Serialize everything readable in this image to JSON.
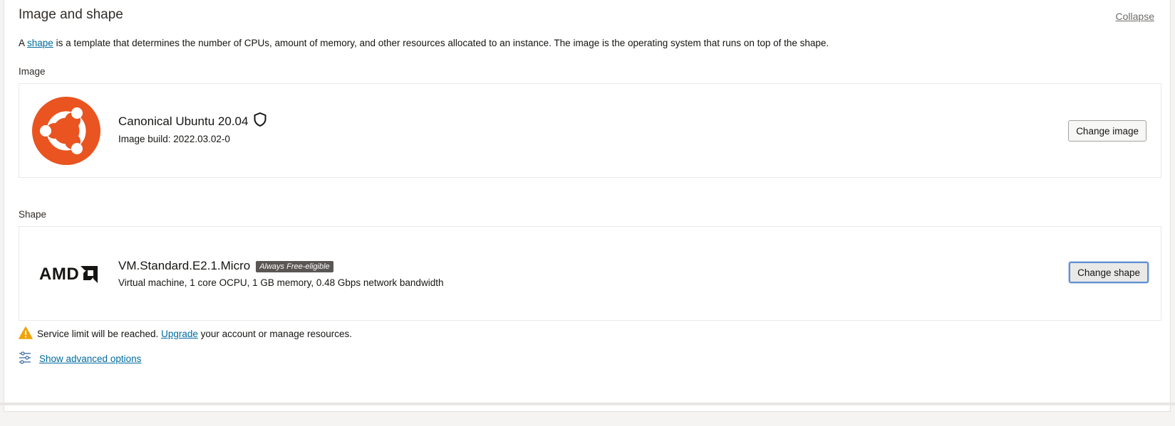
{
  "section": {
    "title": "Image and shape",
    "collapse_label": "Collapse",
    "desc_prefix": "A ",
    "desc_link": "shape",
    "desc_suffix": " is a template that determines the number of CPUs, amount of memory, and other resources allocated to an instance. The image is the operating system that runs on top of the shape."
  },
  "image": {
    "label": "Image",
    "name": "Canonical Ubuntu 20.04",
    "build": "Image build: 2022.03.02-0",
    "button": "Change image",
    "icons": [
      "ubuntu-logo",
      "shield-icon"
    ],
    "logo_color": "#e95420"
  },
  "shape": {
    "label": "Shape",
    "name": "VM.Standard.E2.1.Micro",
    "badge": "Always Free-eligible",
    "details": "Virtual machine, 1 core OCPU, 1 GB memory, 0.48 Gbps network bandwidth",
    "button": "Change shape",
    "logo_text": "AMD"
  },
  "warning": {
    "prefix": "Service limit will be reached. ",
    "link": "Upgrade",
    "suffix": " your account or manage resources.",
    "icon": "warning-icon",
    "color": "#f0a30a"
  },
  "advanced": {
    "label": "Show advanced options",
    "icon": "sliders-icon"
  }
}
